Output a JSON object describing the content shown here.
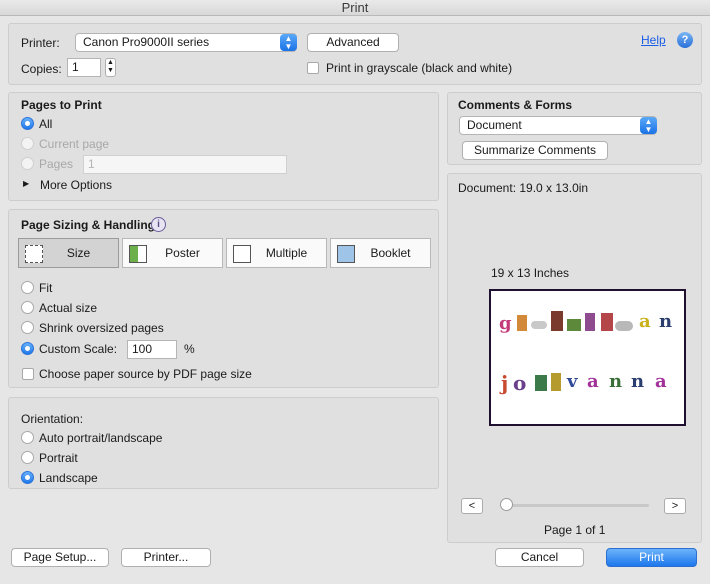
{
  "window": {
    "title": "Print"
  },
  "header": {
    "printer_label": "Printer:",
    "printer_value": "Canon Pro9000II series",
    "advanced_label": "Advanced",
    "help_label": "Help",
    "help_icon": "?",
    "copies_label": "Copies:",
    "copies_value": "1",
    "grayscale_label": "Print in grayscale (black and white)",
    "grayscale_checked": false
  },
  "pages_to_print": {
    "title": "Pages to Print",
    "all": "All",
    "current": "Current page",
    "pages": "Pages",
    "pages_value": "1",
    "more_options": "More Options",
    "selected": "All"
  },
  "sizing": {
    "title": "Page Sizing & Handling",
    "info_icon": "i",
    "tabs": [
      "Size",
      "Poster",
      "Multiple",
      "Booklet"
    ],
    "selected_tab": "Size",
    "fit": "Fit",
    "actual": "Actual size",
    "shrink": "Shrink oversized pages",
    "custom": "Custom Scale:",
    "custom_value": "100",
    "percent": "%",
    "paper_source": "Choose paper source by PDF page size",
    "selected": "Custom Scale:"
  },
  "orientation": {
    "title": "Orientation:",
    "auto": "Auto portrait/landscape",
    "portrait": "Portrait",
    "landscape": "Landscape",
    "selected": "Landscape"
  },
  "comments": {
    "title": "Comments & Forms",
    "value": "Document",
    "summarize": "Summarize Comments"
  },
  "preview": {
    "document_size": "Document: 19.0 x 13.0in",
    "paper_label": "19 x 13 Inches",
    "page_indicator": "Page 1 of 1",
    "prev": "<",
    "next": ">",
    "row1": "gillian",
    "row2": "jovanna"
  },
  "footer": {
    "page_setup": "Page Setup...",
    "printer": "Printer...",
    "cancel": "Cancel",
    "print": "Print"
  },
  "colors": {
    "accent": "#1f78eb",
    "frame": "#1f1030"
  }
}
